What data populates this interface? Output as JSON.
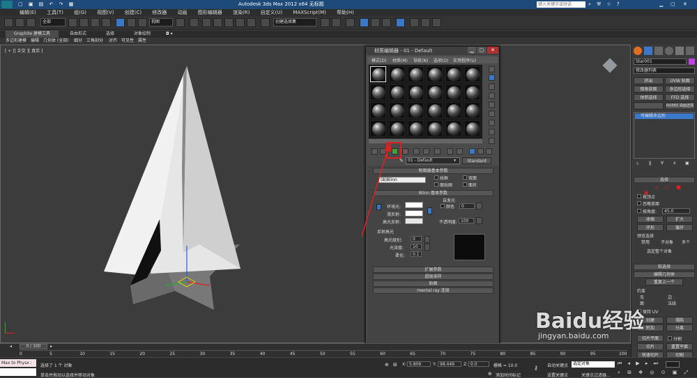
{
  "app": {
    "title": "Autodesk 3ds Max  2012 x64     无标题",
    "search_placeholder": "键入关键字或短语"
  },
  "menu": [
    "编辑(E)",
    "工具(T)",
    "组(G)",
    "视图(V)",
    "创建(C)",
    "修改器",
    "动画",
    "图形编辑器",
    "渲染(R)",
    "自定义(U)",
    "MAXScript(M)",
    "帮助(H)"
  ],
  "toolbar": {
    "selection_filter": "全部",
    "ref_coord": "视图",
    "named_selection": "创建选择集"
  },
  "ribbon": {
    "tabs": [
      "Graphite 建模工具",
      "自由形式",
      "选择",
      "对象绘制"
    ],
    "subtabs": [
      "多边形建模",
      "编辑",
      "几何体 (全部)",
      "细分",
      "三角剖分",
      "对齐",
      "可见性",
      "属性"
    ]
  },
  "viewport": {
    "label": "[ + ][ 正交 ][ 真实 ]"
  },
  "material_editor": {
    "title": "材质编辑器 - 01 - Default",
    "menus": [
      "模式(D)",
      "材质(M)",
      "导航(N)",
      "选项(O)",
      "实用程序(U)"
    ],
    "material_name": "01 - Default",
    "material_type": "Standard",
    "shader_section": "明暗器基本参数",
    "shader_type": "(B)Blinn",
    "shader_options": [
      "线框",
      "双面",
      "面贴图",
      "面状"
    ],
    "blinn_section": "Blinn 基本参数",
    "self_illum": "自发光",
    "color_label": "颜色",
    "color_value": "0",
    "ambient_label": "环境光:",
    "diffuse_label": "漫反射:",
    "specular_label": "高光反射:",
    "opacity_label": "不透明度:",
    "opacity_value": "100",
    "highlight_section": "反射高光",
    "spec_level_label": "高光级别:",
    "spec_level_value": "0",
    "gloss_label": "光泽度:",
    "gloss_value": "10",
    "soften_label": "柔化:",
    "soften_value": "0.1",
    "rollouts": [
      "扩展参数",
      "超级采样",
      "贴图",
      "mental ray 连接"
    ]
  },
  "cmdpanel": {
    "object_name": "Star001",
    "modifier_list": "修改器列表",
    "modifier_buttons": [
      "挤出",
      "UVW 贴图",
      "倒角剖面",
      "多边形选择",
      "体积选择",
      "FFD 选择",
      "",
      "NURBS 曲面选择"
    ],
    "stack_item": "可编辑多边形",
    "select_rollout": "选择",
    "by_vertex": "按顶点",
    "ignore_back": "忽略背面",
    "by_angle": "按角度:",
    "angle_value": "45.0",
    "shrink": "收缩",
    "grow": "扩大",
    "ring": "环形",
    "loop": "循环",
    "preview_sel": "预览选择",
    "preview_opts": [
      "禁用",
      "子对象",
      "多个"
    ],
    "whole_sel": "选定整个对象",
    "soft_sel": "软选择",
    "edit_geo": "编辑几何体",
    "repeat_last": "重复上一个",
    "constraints": "约束",
    "constraint_opts": [
      "无",
      "边",
      "面",
      "法线"
    ],
    "preserve_uv": "保持 UV",
    "create": "创建",
    "collapse": "塌陷",
    "attach": "附加",
    "detach": "分离",
    "slice_plane": "切片平面",
    "split": "分割",
    "slice": "切片",
    "reset_plane": "重置平面",
    "quickslice": "快速切片",
    "cut": "切割"
  },
  "timeline": {
    "frame": "0 / 100",
    "ticks": [
      "0",
      "5",
      "10",
      "15",
      "20",
      "25",
      "30",
      "35",
      "40",
      "45",
      "50",
      "55",
      "60",
      "65",
      "70",
      "75",
      "80",
      "85",
      "90",
      "95",
      "100"
    ]
  },
  "status": {
    "maxscript": "Max to Physx :",
    "selected": "选择了 1 个 对象",
    "prompt": "单击并拖动以选择并移动对象",
    "x_label": "X:",
    "x_value": "5.809",
    "y_label": "Y:",
    "y_value": "98.449",
    "z_label": "Z:",
    "z_value": "0.0",
    "grid": "栅格 = 10.0",
    "autokey": "自动关键点",
    "selected_set": "选定对象",
    "set_key": "设置关键点",
    "key_filter": "关键点过滤器...",
    "add_time_tag": "添加时间标记"
  },
  "watermark": {
    "brand": "Baidu经验",
    "url": "jingyan.baidu.com"
  },
  "colors": {
    "accent": "#3c78c8",
    "annotation": "#e02020",
    "title_bar": "#1d4a78"
  }
}
